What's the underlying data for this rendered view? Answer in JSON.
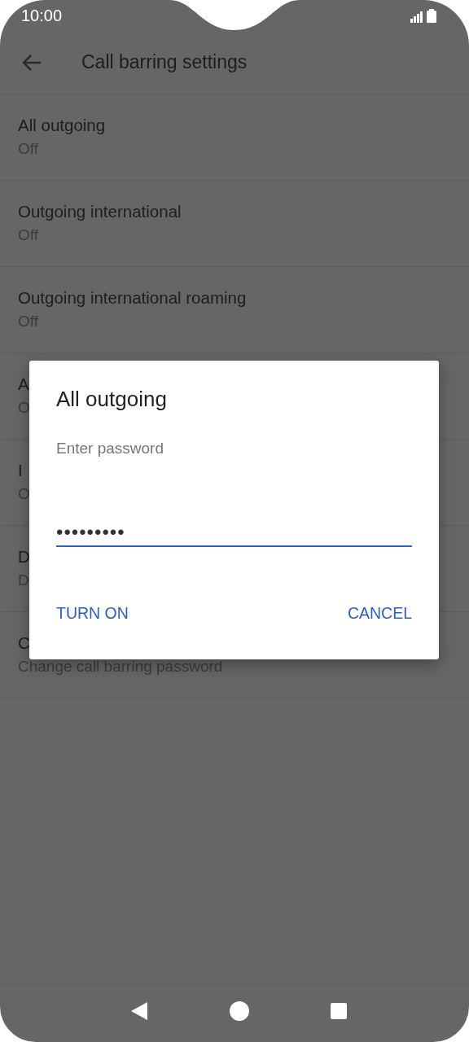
{
  "status_bar": {
    "time": "10:00"
  },
  "app_bar": {
    "title": "Call barring settings"
  },
  "settings": [
    {
      "title": "All outgoing",
      "summary": "Off"
    },
    {
      "title": "Outgoing international",
      "summary": "Off"
    },
    {
      "title": "Outgoing international roaming",
      "summary": "Off"
    },
    {
      "title": "A",
      "summary": "O"
    },
    {
      "title": "I",
      "summary": "O"
    },
    {
      "title": "D",
      "summary": "D"
    },
    {
      "title": "C",
      "summary": "Change call barring password"
    }
  ],
  "dialog": {
    "title": "All outgoing",
    "label": "Enter password",
    "value": "•••••••••",
    "buttons": [
      {
        "label": "TURN ON"
      },
      {
        "label": "CANCEL"
      }
    ]
  }
}
